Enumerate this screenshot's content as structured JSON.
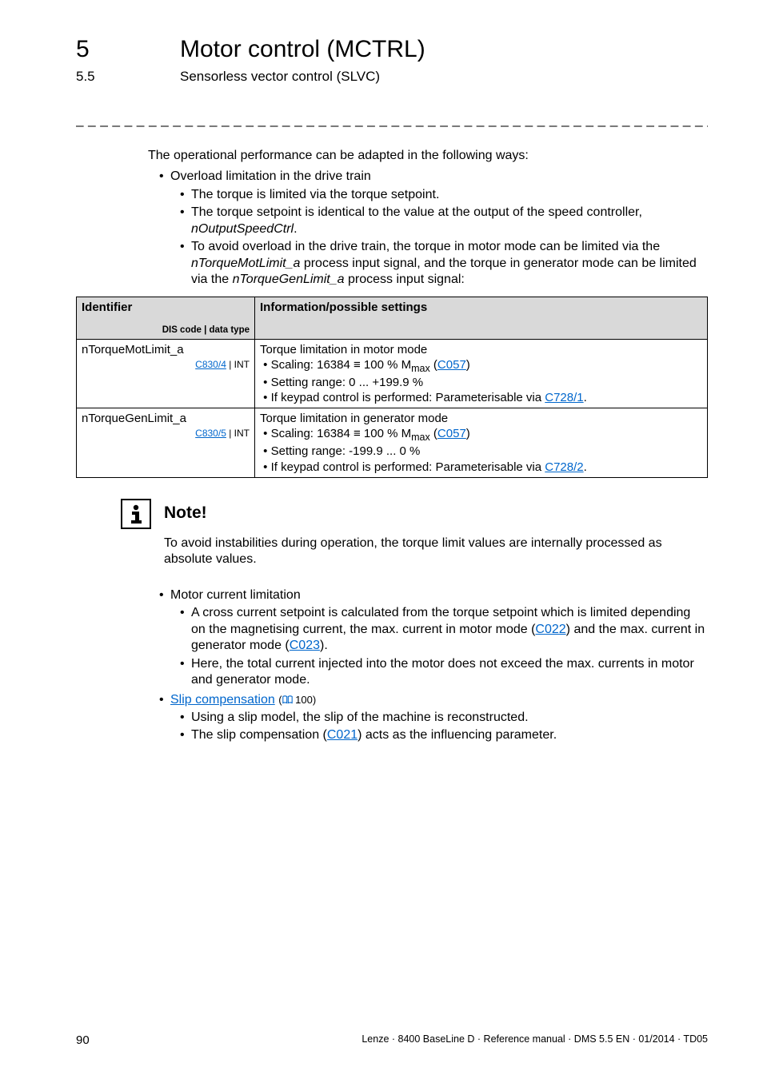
{
  "header": {
    "chapter_num": "5",
    "chapter_title": "Motor control (MCTRL)",
    "section_num": "5.5",
    "section_title": "Sensorless vector control (SLVC)"
  },
  "intro": "The operational performance can be adapted in the following ways:",
  "b1": {
    "head": "Overload limitation in the drive train",
    "i1": "The torque is limited via the torque setpoint.",
    "i2a": "The torque setpoint is identical to the value at the output of the speed controller, ",
    "i2b": "nOutputSpeedCtrl",
    "i2c": ".",
    "i3a": "To avoid overload in the drive train, the torque in motor mode can be limited via the ",
    "i3b": "nTorqueMotLimit_a",
    "i3c": " process input signal, and the torque in generator mode can be limited via the ",
    "i3d": "nTorqueGenLimit_a",
    "i3e": " process input signal:"
  },
  "table": {
    "h1": "Identifier",
    "h1_sub": "DIS code | data type",
    "h2": "Information/possible settings",
    "r1": {
      "id": "nTorqueMotLimit_a",
      "code": "C830/4",
      "codetype": " | INT",
      "d1": "Torque limitation in motor mode",
      "d2a": "Scaling: 16384 ≡ 100 % M",
      "d2b": "max",
      "d2c": " (",
      "d2d": "C057",
      "d2e": ")",
      "d3": "Setting range: 0 ... +199.9 %",
      "d4a": "If keypad control is performed: Parameterisable via ",
      "d4b": "C728/1",
      "d4c": "."
    },
    "r2": {
      "id": "nTorqueGenLimit_a",
      "code": "C830/5",
      "codetype": " | INT",
      "d1": "Torque limitation in generator mode",
      "d2a": "Scaling: 16384 ≡ 100 % M",
      "d2b": "max",
      "d2c": " (",
      "d2d": "C057",
      "d2e": ")",
      "d3": "Setting range: -199.9 ... 0 %",
      "d4a": "If keypad control is performed: Parameterisable via ",
      "d4b": "C728/2",
      "d4c": "."
    }
  },
  "note": {
    "label": "Note!",
    "body": "To avoid instabilities during operation, the torque limit values are internally processed as absolute values."
  },
  "b2": {
    "head": "Motor current limitation",
    "i1a": "A cross current setpoint is calculated from the torque setpoint which is limited depending on the magnetising current, the max. current in motor mode (",
    "i1b": "C022",
    "i1c": ") and the max. current in generator mode (",
    "i1d": "C023",
    "i1e": ").",
    "i2": "Here, the total current injected into the motor does not exceed the max. currents in motor and generator mode."
  },
  "b3": {
    "headlink": "Slip compensation",
    "ref": " 100)",
    "i1": "Using a slip model, the slip of the machine is reconstructed.",
    "i2a": "The slip compensation (",
    "i2b": "C021",
    "i2c": ") acts as the influencing parameter."
  },
  "footer": {
    "page": "90",
    "right": "Lenze · 8400 BaseLine D · Reference manual · DMS 5.5 EN · 01/2014 · TD05"
  }
}
